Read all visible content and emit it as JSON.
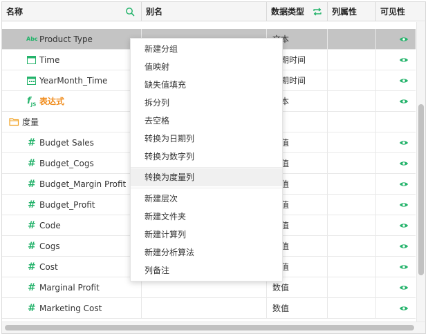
{
  "header": {
    "name": "名称",
    "alias": "别名",
    "data_type": "数据类型",
    "column_attr": "列属性",
    "visibility": "可见性",
    "search_icon": "search-icon",
    "swap_icon": "swap-icon"
  },
  "rows": [
    {
      "icon": "text-abc-icon",
      "glyph": "Abc",
      "name": "Product Type",
      "type": "文本",
      "visible": true,
      "selected": true
    },
    {
      "icon": "calendar-icon",
      "name": "Time",
      "type": "日期时间",
      "visible": true
    },
    {
      "icon": "calendar-icon",
      "name": "YearMonth_Time",
      "type": "日期时间",
      "visible": true
    },
    {
      "icon": "expression-icon",
      "glyph": "f",
      "glyph_sub": "JS",
      "name": "表达式",
      "type": "文本",
      "visible": true
    },
    {
      "icon": "folder-icon",
      "name": "度量",
      "type": "",
      "visible": false,
      "folder": true
    },
    {
      "icon": "hash-icon",
      "glyph": "#",
      "name": "Budget Sales",
      "type": "数值",
      "visible": true
    },
    {
      "icon": "hash-icon",
      "glyph": "#",
      "name": "Budget_Cogs",
      "type": "数值",
      "visible": true
    },
    {
      "icon": "hash-icon",
      "glyph": "#",
      "name": "Budget_Margin Profit",
      "type": "数值",
      "visible": true
    },
    {
      "icon": "hash-icon",
      "glyph": "#",
      "name": "Budget_Profit",
      "type": "数值",
      "visible": true
    },
    {
      "icon": "hash-icon",
      "glyph": "#",
      "name": "Code",
      "type": "数值",
      "visible": true
    },
    {
      "icon": "hash-icon",
      "glyph": "#",
      "name": "Cogs",
      "type": "数值",
      "visible": true
    },
    {
      "icon": "hash-icon",
      "glyph": "#",
      "name": "Cost",
      "type": "数值",
      "visible": true
    },
    {
      "icon": "hash-icon",
      "glyph": "#",
      "name": "Marginal Profit",
      "type": "数值",
      "visible": true
    },
    {
      "icon": "hash-icon",
      "glyph": "#",
      "name": "Marketing Cost",
      "type": "数值",
      "visible": true
    }
  ],
  "context_menu": {
    "items": [
      "新建分组",
      "值映射",
      "缺失值填充",
      "拆分列",
      "去空格",
      "转换为日期列",
      "转换为数字列",
      "转换为度量列",
      "新建层次",
      "新建文件夹",
      "新建计算列",
      "新建分析算法",
      "列备注"
    ],
    "highlighted_index": 7
  },
  "colors": {
    "accent_green": "#24b36b",
    "expression_orange": "#f08c1c",
    "folder_orange": "#f0a020",
    "selected_row": "#c4c4c4"
  }
}
